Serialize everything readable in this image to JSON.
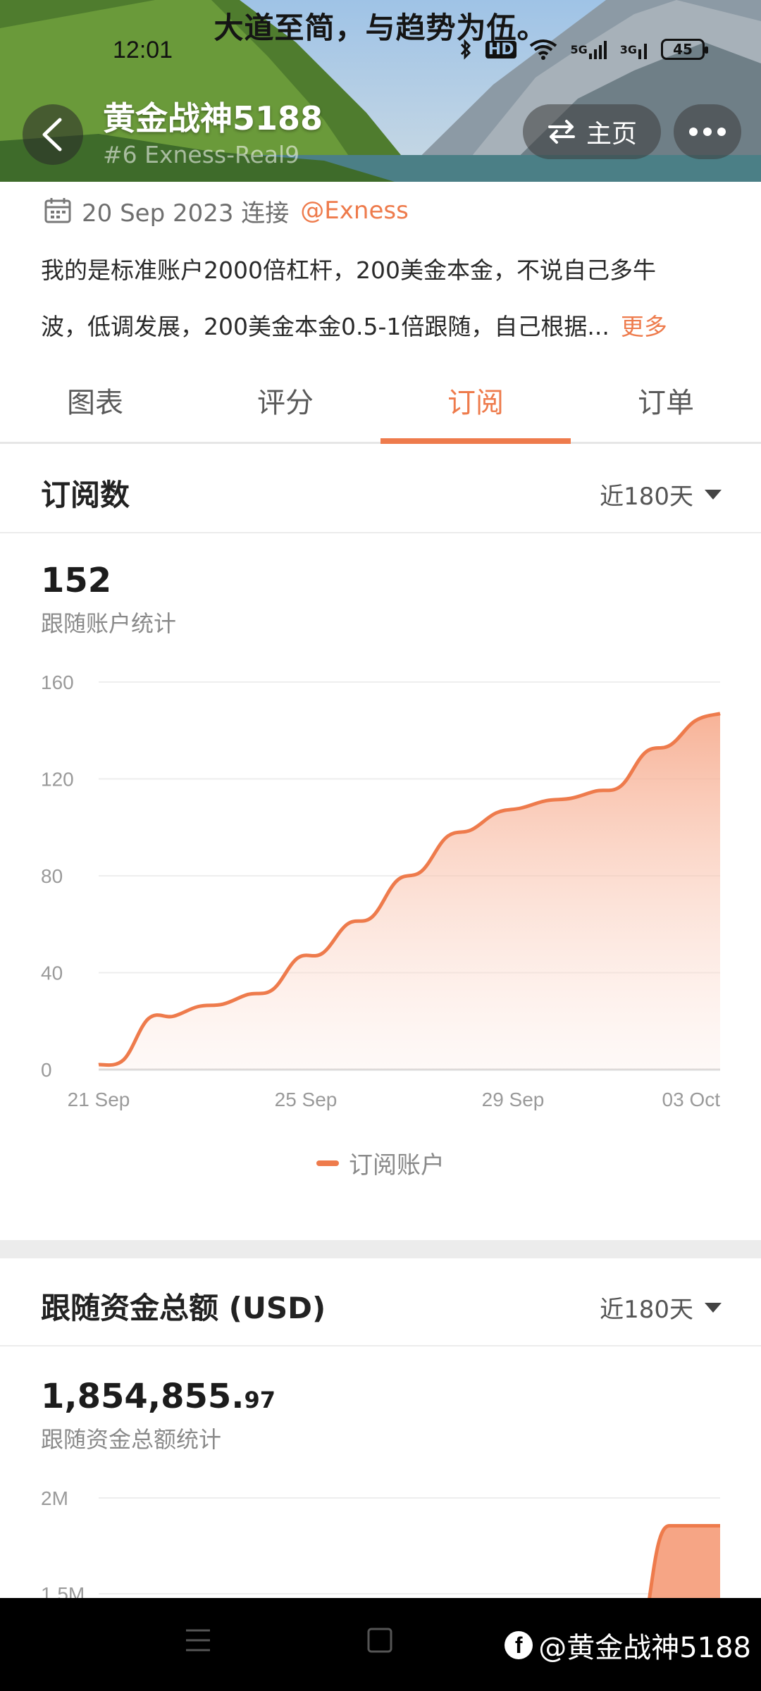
{
  "banner": {
    "slogan": "大道至简，与趋势为伍。"
  },
  "status_bar": {
    "time": "12:01",
    "bluetooth_icon": "bluetooth-icon",
    "hd_badge": "HD",
    "network_5g": "5G",
    "network_3g": "3G",
    "battery": "45"
  },
  "profile": {
    "name": "黄金战神5188",
    "subtitle": "#6  Exness-Real9",
    "home_label": "主页"
  },
  "info": {
    "date": "20 Sep 2023 连接",
    "broker": "@Exness",
    "description_line1": "我的是标准账户2000倍杠杆，200美金本金，不说自己多牛",
    "description_line2": "波，低调发展，200美金本金0.5-1倍跟随，自己根据...",
    "more_label": "更多"
  },
  "tabs": [
    {
      "label": "图表",
      "active": false
    },
    {
      "label": "评分",
      "active": false
    },
    {
      "label": "订阅",
      "active": true
    },
    {
      "label": "订单",
      "active": false
    }
  ],
  "subscribers": {
    "title": "订阅数",
    "range": "近180天",
    "value": "152",
    "caption": "跟随账户统计"
  },
  "funds": {
    "title": "跟随资金总额 (USD)",
    "range": "近180天",
    "value_main": "1,854,855.",
    "value_decimal": "97",
    "caption": "跟随资金总额统计"
  },
  "chart_data": [
    {
      "type": "area",
      "title": "",
      "ylim": [
        0,
        160
      ],
      "y_ticks": [
        "0",
        "40",
        "80",
        "120",
        "160"
      ],
      "x_tick_labels": [
        "21 Sep",
        "25 Sep",
        "29 Sep",
        "03 Oct"
      ],
      "grid": true,
      "legend_position": "bottom-center",
      "x": [
        "21 Sep",
        "21 Sep",
        "22 Sep",
        "22 Sep",
        "23 Sep",
        "23 Sep",
        "24 Sep",
        "24 Sep",
        "25 Sep",
        "25 Sep",
        "26 Sep",
        "26 Sep",
        "27 Sep",
        "27 Sep",
        "28 Sep",
        "28 Sep",
        "29 Sep",
        "29 Sep",
        "30 Sep",
        "30 Sep",
        "01 Oct",
        "01 Oct",
        "02 Oct",
        "02 Oct",
        "03 Oct",
        "03 Oct"
      ],
      "series": [
        {
          "name": "订阅账户",
          "color": "#ee7b4c",
          "values": [
            2,
            4,
            21,
            22,
            26,
            27,
            31,
            33,
            46,
            48,
            60,
            63,
            78,
            82,
            96,
            99,
            106,
            108,
            111,
            112,
            115,
            117,
            131,
            134,
            144,
            147
          ]
        }
      ]
    },
    {
      "type": "area",
      "title": "",
      "y_ticks": [
        "2M",
        "1.5M"
      ],
      "grid": true,
      "series": [
        {
          "color": "#ee7b4c",
          "values": [
            0,
            0,
            0,
            0,
            0,
            0,
            0,
            0,
            1854856,
            1854856
          ]
        }
      ]
    }
  ],
  "navbar": {
    "menu_icon": "menu-icon",
    "home_icon": "square-home-icon",
    "watermark": "@黄金战神5188"
  }
}
